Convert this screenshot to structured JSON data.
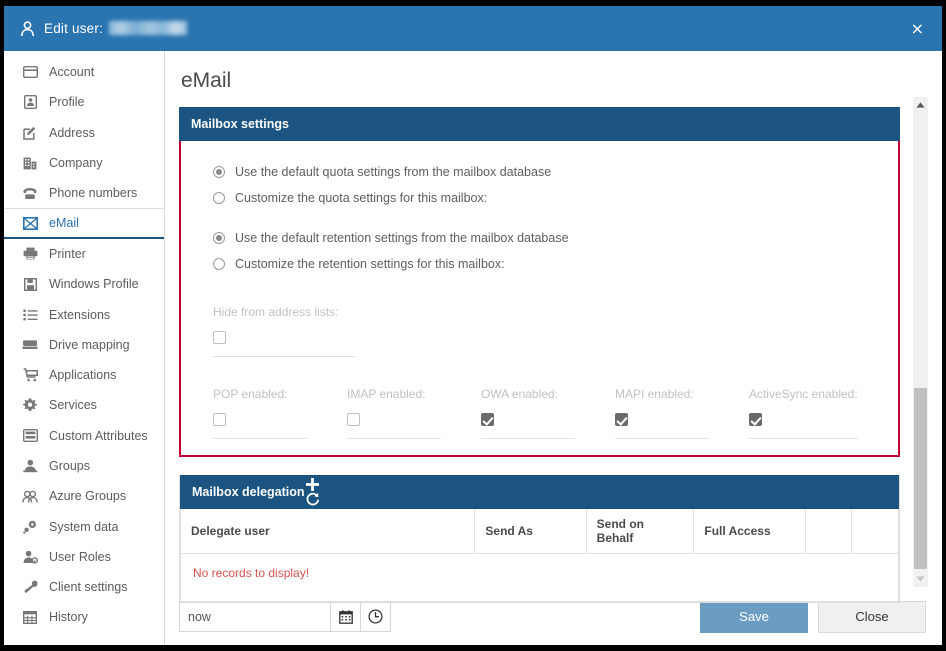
{
  "window": {
    "title_prefix": "Edit user:",
    "username_redacted": "",
    "close_label": "×",
    "user_icon": "person-icon"
  },
  "sidebar": {
    "items": [
      {
        "label": "Account",
        "icon": "card-icon",
        "active": false
      },
      {
        "label": "Profile",
        "icon": "profile-icon",
        "active": false
      },
      {
        "label": "Address",
        "icon": "edit-note-icon",
        "active": false
      },
      {
        "label": "Company",
        "icon": "building-icon",
        "active": false
      },
      {
        "label": "Phone numbers",
        "icon": "phone-icon",
        "active": false
      },
      {
        "label": "eMail",
        "icon": "envelope-icon",
        "active": true
      },
      {
        "label": "Printer",
        "icon": "printer-icon",
        "active": false
      },
      {
        "label": "Windows Profile",
        "icon": "floppy-icon",
        "active": false
      },
      {
        "label": "Extensions",
        "icon": "list-icon",
        "active": false
      },
      {
        "label": "Drive mapping",
        "icon": "drive-icon",
        "active": false
      },
      {
        "label": "Applications",
        "icon": "cart-icon",
        "active": false
      },
      {
        "label": "Services",
        "icon": "gear-icon",
        "active": false
      },
      {
        "label": "Custom Attributes",
        "icon": "drawer-icon",
        "active": false
      },
      {
        "label": "Groups",
        "icon": "group-icon",
        "active": false
      },
      {
        "label": "Azure Groups",
        "icon": "azure-group-icon",
        "active": false
      },
      {
        "label": "System data",
        "icon": "system-data-icon",
        "active": false
      },
      {
        "label": "User Roles",
        "icon": "user-key-icon",
        "active": false
      },
      {
        "label": "Client settings",
        "icon": "wrench-icon",
        "active": false
      },
      {
        "label": "History",
        "icon": "history-icon",
        "active": false
      }
    ]
  },
  "main": {
    "page_title": "eMail",
    "mailbox_settings": {
      "header": "Mailbox settings",
      "border_color": "#c40233",
      "header_color": "#1b5480",
      "quota_options": [
        {
          "label": "Use the default quota settings from the mailbox database",
          "selected": true
        },
        {
          "label": "Customize the quota settings for this mailbox:",
          "selected": false
        }
      ],
      "retention_options": [
        {
          "label": "Use the default retention settings from the mailbox database",
          "selected": true
        },
        {
          "label": "Customize the retention settings for this mailbox:",
          "selected": false
        }
      ],
      "hide_from_address_lists": {
        "label": "Hide from address lists:",
        "checked": false
      },
      "protocols": [
        {
          "label": "POP enabled:",
          "checked": false
        },
        {
          "label": "IMAP enabled:",
          "checked": false
        },
        {
          "label": "OWA enabled:",
          "checked": true
        },
        {
          "label": "MAPI enabled:",
          "checked": true
        },
        {
          "label": "ActiveSync enabled:",
          "checked": true
        }
      ]
    },
    "mailbox_delegation": {
      "header": "Mailbox delegation",
      "add_icon": "plus-icon",
      "refresh_icon": "refresh-icon",
      "columns": [
        "Delegate user",
        "Send As",
        "Send on Behalf",
        "Full Access",
        "",
        ""
      ],
      "empty_message": "No records to display!",
      "empty_message_color": "#d9534f"
    }
  },
  "footer": {
    "datetime_value": "now",
    "calendar_icon": "calendar-icon",
    "clock_icon": "clock-icon",
    "save_label": "Save",
    "close_label": "Close",
    "save_color": "#6b9dc2"
  },
  "scrollbar": {
    "up_icon": "triangle-up-icon",
    "down_icon": "triangle-down-icon"
  }
}
